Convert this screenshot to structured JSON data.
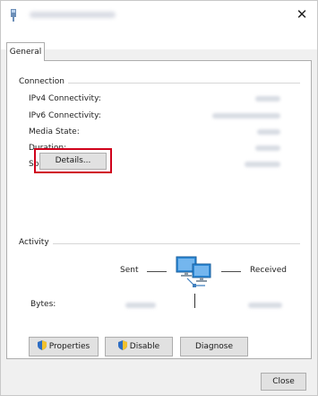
{
  "tab": {
    "label": "General"
  },
  "connection": {
    "group_label": "Connection",
    "rows": [
      {
        "label": "IPv4 Connectivity:"
      },
      {
        "label": "IPv6 Connectivity:"
      },
      {
        "label": "Media State:"
      },
      {
        "label": "Duration:"
      },
      {
        "label": "Speed:"
      }
    ],
    "details_label": "Details..."
  },
  "activity": {
    "group_label": "Activity",
    "sent_label": "Sent",
    "received_label": "Received",
    "bytes_label": "Bytes:"
  },
  "buttons": {
    "properties": "Properties",
    "disable": "Disable",
    "diagnose": "Diagnose"
  },
  "footer": {
    "close_label": "Close"
  },
  "icons": {
    "title": "network-adapter-icon",
    "close": "close-icon",
    "network": "network-computers-icon",
    "shield": "uac-shield-icon"
  },
  "colors": {
    "highlight": "#d0021b",
    "accent": "#2d89d6"
  }
}
